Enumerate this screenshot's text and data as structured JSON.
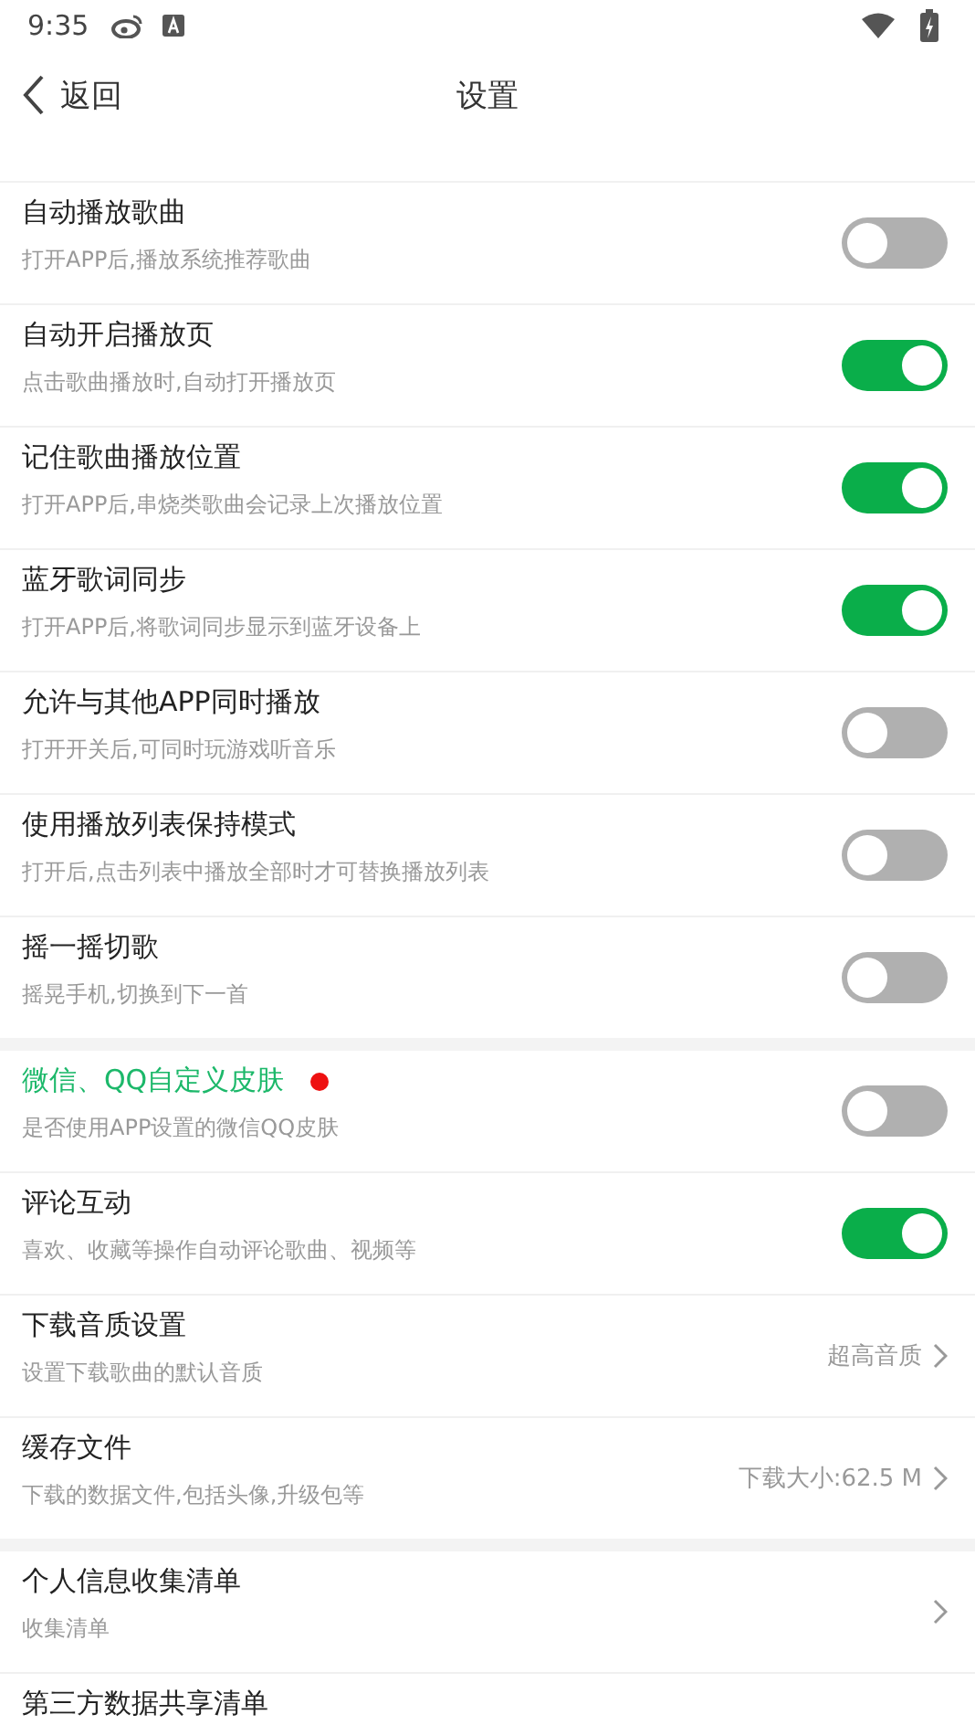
{
  "status_bar": {
    "time": "9:35"
  },
  "header": {
    "back": "返回",
    "title": "设置"
  },
  "groups": [
    {
      "items": [
        {
          "kind": "toggle",
          "title": "自动播放歌曲",
          "subtitle": "打开APP后,播放系统推荐歌曲",
          "on": false
        },
        {
          "kind": "toggle",
          "title": "自动开启播放页",
          "subtitle": "点击歌曲播放时,自动打开播放页",
          "on": true
        },
        {
          "kind": "toggle",
          "title": "记住歌曲播放位置",
          "subtitle": "打开APP后,串烧类歌曲会记录上次播放位置",
          "on": true
        },
        {
          "kind": "toggle",
          "title": "蓝牙歌词同步",
          "subtitle": "打开APP后,将歌词同步显示到蓝牙设备上",
          "on": true
        },
        {
          "kind": "toggle",
          "title": "允许与其他APP同时播放",
          "subtitle": "打开开关后,可同时玩游戏听音乐",
          "on": false
        },
        {
          "kind": "toggle",
          "title": "使用播放列表保持模式",
          "subtitle": "打开后,点击列表中播放全部时才可替换播放列表",
          "on": false
        },
        {
          "kind": "toggle",
          "title": "摇一摇切歌",
          "subtitle": "摇晃手机,切换到下一首",
          "on": false
        }
      ]
    },
    {
      "items": [
        {
          "kind": "toggle",
          "title": "微信、QQ自定义皮肤",
          "subtitle": "是否使用APP设置的微信QQ皮肤",
          "on": false,
          "highlighted": true,
          "new_dot": true
        },
        {
          "kind": "toggle",
          "title": "评论互动",
          "subtitle": "喜欢、收藏等操作自动评论歌曲、视频等",
          "on": true
        },
        {
          "kind": "link",
          "title": "下载音质设置",
          "subtitle": "设置下载歌曲的默认音质",
          "value": "超高音质",
          "chevron": true
        },
        {
          "kind": "link",
          "title": "缓存文件",
          "subtitle": "下载的数据文件,包括头像,升级包等",
          "value": "下载大小:62.5 M",
          "chevron": true
        }
      ]
    },
    {
      "items": [
        {
          "kind": "link",
          "title": "个人信息收集清单",
          "subtitle": "收集清单",
          "chevron": true
        },
        {
          "kind": "link",
          "title": "第三方数据共享清单",
          "chevron": false
        }
      ]
    }
  ]
}
